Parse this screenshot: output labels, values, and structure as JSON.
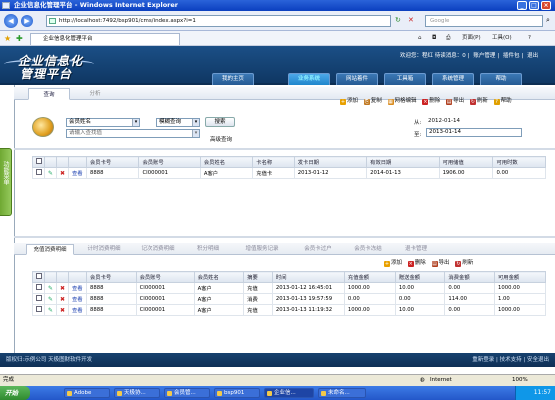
{
  "window": {
    "title": "企业信息化管理平台 - Windows Internet Explorer",
    "min": "_",
    "max": "□",
    "close": "×"
  },
  "browser": {
    "url": "http://localhost:7492/bsp901/cms/index.aspx?i=1",
    "search_placeholder": "Google",
    "tab_title": "企业信息化管理平台",
    "page_menu": "页面(P)",
    "tools_menu": "工具(O)",
    "help_menu": "?"
  },
  "header": {
    "logo_line1": "企业信息化",
    "logo_line2": "管理平台",
    "user_greeting": "欢迎您：程红 待读消息：0",
    "account": "账户管理",
    "plugins": "插件包",
    "exit": "退出"
  },
  "main_nav": [
    {
      "label": "我的主页"
    },
    {
      "label": "业务系统"
    },
    {
      "label": "网站着件"
    },
    {
      "label": "工具箱"
    },
    {
      "label": "系统管理"
    },
    {
      "label": "帮助"
    }
  ],
  "side_tab": "功能菜单",
  "sub_tabs": [
    {
      "label": "查询"
    },
    {
      "label": "分析"
    }
  ],
  "toolbar": {
    "add": "添加",
    "copy": "复制",
    "grid_edit": "网格编辑",
    "delete": "删除",
    "export": "导出",
    "refresh": "刷新",
    "help": "帮助"
  },
  "query": {
    "field": "会员姓名",
    "mode": "模糊查询",
    "placeholder": "请输入查找值",
    "search": "搜索",
    "advanced": "高级查询",
    "from_label": "从:",
    "from_date": "2012-01-14",
    "to_label": "至:",
    "to_date": "2013-01-14"
  },
  "main_table": {
    "headers": [
      "会员卡号",
      "会员账号",
      "会员姓名",
      "卡名称",
      "发卡日期",
      "有效日期",
      "可用储值",
      "可用时数"
    ],
    "rows": [
      {
        "card_no": "8888",
        "account": "CI000001",
        "name": "A客户",
        "card_name": "充值卡",
        "issue_date": "2013-01-12",
        "valid_date": "2014-01-13",
        "balance": "1906.00",
        "hours": "0.00",
        "view": "查看"
      }
    ]
  },
  "detail_tabs": [
    {
      "label": "充值消费明细"
    },
    {
      "label": "计时消费明细"
    },
    {
      "label": "记次消费明细"
    },
    {
      "label": "积分明细"
    },
    {
      "label": "增值服务记录"
    },
    {
      "label": "会员卡过户"
    },
    {
      "label": "会员卡冻结"
    },
    {
      "label": "退卡管理"
    }
  ],
  "detail_toolbar": {
    "add": "添加",
    "delete": "删除",
    "export": "导出",
    "refresh": "刷新"
  },
  "detail_table": {
    "headers": [
      "会员卡号",
      "会员账号",
      "会员姓名",
      "摘要",
      "时间",
      "充值金额",
      "赠送金额",
      "消费金额",
      "可用金额"
    ],
    "rows": [
      {
        "card_no": "8888",
        "account": "CI000001",
        "name": "A客户",
        "summary": "充值",
        "time": "2013-01-12 16:45:01",
        "charge": "1000.00",
        "gift": "10.00",
        "spend": "0.00",
        "avail": "1000.00",
        "view": "查看"
      },
      {
        "card_no": "8888",
        "account": "CI000001",
        "name": "A客户",
        "summary": "消费",
        "time": "2013-01-13 19:57:59",
        "charge": "0.00",
        "gift": "0.00",
        "spend": "114.00",
        "avail": "1.00",
        "view": "查看"
      },
      {
        "card_no": "8888",
        "account": "CI000001",
        "name": "A客户",
        "summary": "充值",
        "time": "2013-01-13 11:19:32",
        "charge": "1000.00",
        "gift": "10.00",
        "spend": "0.00",
        "avail": "1000.00",
        "view": "查看"
      }
    ]
  },
  "footer": {
    "copyright": "版权归:示例公司 天极图财软件开发",
    "relogin": "重新登录",
    "support": "技术支持",
    "safe_exit": "安全退出"
  },
  "status": {
    "left": "完成",
    "zone": "Internet",
    "zoom": "100%"
  },
  "taskbar": {
    "start": "开始",
    "tasks": [
      "Adobe",
      "天极协...",
      "会员管...",
      "bsp901",
      "企业信...",
      "未命名..."
    ],
    "clock": "11:57"
  }
}
